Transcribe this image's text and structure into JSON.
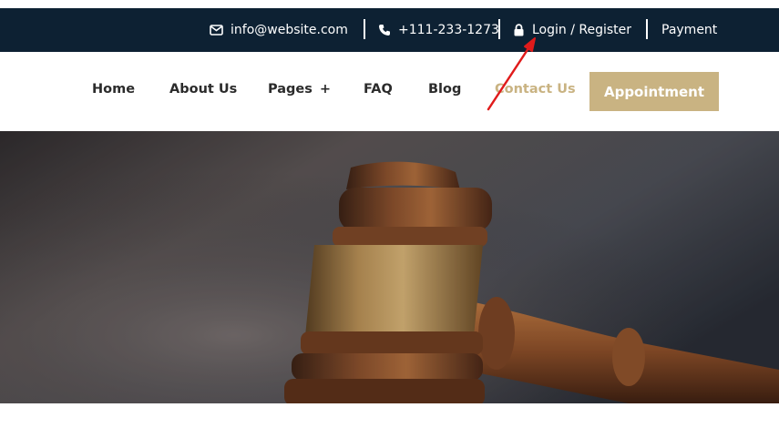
{
  "topbar": {
    "email": "info@website.com",
    "phone": "+111-233-1273",
    "auth": "Login / Register",
    "payment": "Payment",
    "bg_color": "#0d2133"
  },
  "nav": {
    "items": [
      {
        "label": "Home"
      },
      {
        "label": "About Us"
      },
      {
        "label": "Pages"
      },
      {
        "label": "FAQ"
      },
      {
        "label": "Blog"
      },
      {
        "label": "Contact Us"
      }
    ],
    "pages_toggle": "+",
    "active_label": "Contact Us",
    "cta_label": "Appointment",
    "accent_color": "#c9b382"
  },
  "hero": {
    "image": "judge-gavel-photo"
  },
  "annotation": {
    "color": "#e01b1b",
    "points_to": "Login / Register"
  },
  "icons": {
    "email": "envelope-icon",
    "phone": "phone-icon",
    "auth": "lock-icon"
  }
}
